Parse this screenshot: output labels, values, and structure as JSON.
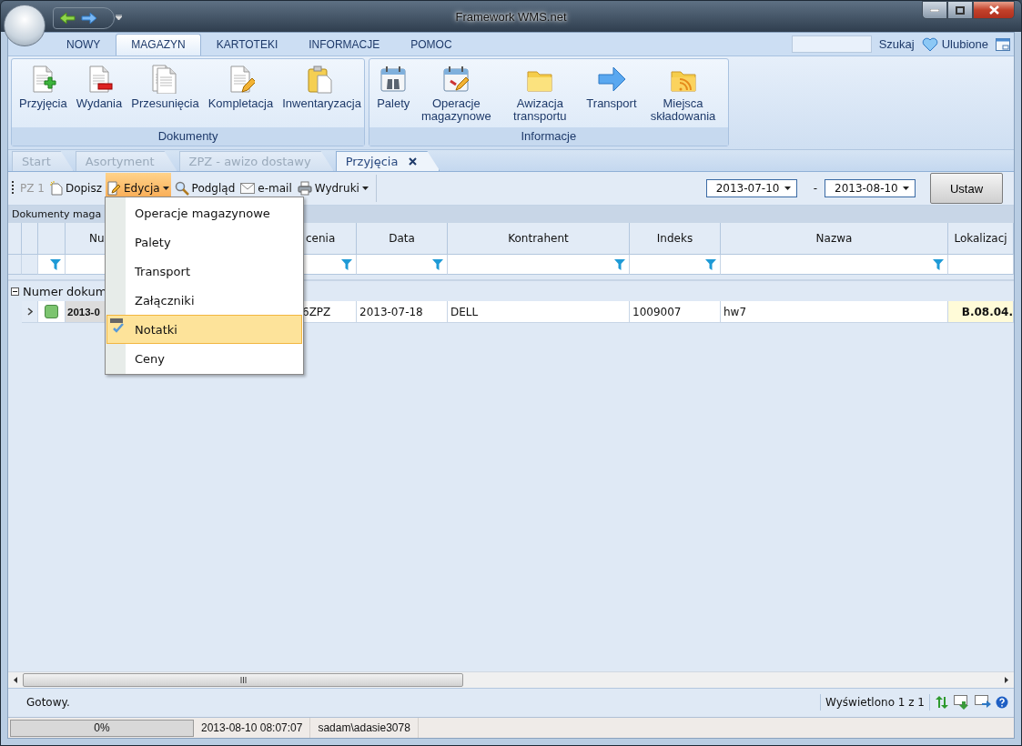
{
  "window": {
    "title": "Framework WMS.net"
  },
  "ribbon": {
    "tabs": [
      {
        "label": "NOWY",
        "selected": false
      },
      {
        "label": "MAGAZYN",
        "selected": true
      },
      {
        "label": "KARTOTEKI",
        "selected": false
      },
      {
        "label": "INFORMACJE",
        "selected": false
      },
      {
        "label": "POMOC",
        "selected": false
      }
    ],
    "search": {
      "button": "Szukaj"
    },
    "favorites": "Ulubione",
    "groups": [
      {
        "label": "Dokumenty",
        "buttons": [
          {
            "label": "Przyjęcia",
            "kind": "doc-add"
          },
          {
            "label": "Wydania",
            "kind": "doc-remove"
          },
          {
            "label": "Przesunięcia",
            "kind": "docs"
          },
          {
            "label": "Kompletacja",
            "kind": "doc-edit"
          },
          {
            "label": "Inwentaryzacja",
            "kind": "clipboard"
          }
        ]
      },
      {
        "label": "Informacje",
        "buttons": [
          {
            "label": "Palety",
            "kind": "calendar-binoculars"
          },
          {
            "label": "Operacje magazynowe",
            "kind": "calendar-edit"
          },
          {
            "label": "Awizacja transportu",
            "kind": "folder"
          },
          {
            "label": "Transport",
            "kind": "arrow"
          },
          {
            "label": "Miejsca składowania",
            "kind": "folder-feed"
          }
        ]
      }
    ]
  },
  "doc_tabs": [
    {
      "label": "Start",
      "selected": false,
      "closable": false
    },
    {
      "label": "Asortyment",
      "selected": false,
      "closable": false
    },
    {
      "label": "ZPZ - awizo dostawy",
      "selected": false,
      "closable": false
    },
    {
      "label": "Przyjęcia",
      "selected": true,
      "closable": true
    }
  ],
  "toolbar": {
    "items": [
      {
        "label": "PZ 1",
        "kind": "label",
        "disabled": true
      },
      {
        "label": "Dopisz",
        "kind": "new",
        "open": false
      },
      {
        "label": "Edycja",
        "kind": "edit-dropdown",
        "open": true
      },
      {
        "label": "Podgląd",
        "kind": "search",
        "open": false
      },
      {
        "label": "e-mail",
        "kind": "mail",
        "open": false
      },
      {
        "label": "Wydruki",
        "kind": "print-dropdown",
        "open": false
      }
    ],
    "date_from": "2013-07-10",
    "date_separator": "-",
    "date_to": "2013-08-10",
    "apply_button": "Ustaw"
  },
  "grid": {
    "caption": "Dokumenty maga",
    "marker_column_filter": true,
    "columns": [
      {
        "label": "Nu",
        "filter": false
      },
      {
        "label": "cenia",
        "filter": true
      },
      {
        "label": "Data",
        "filter": true
      },
      {
        "label": "Kontrahent",
        "filter": true
      },
      {
        "label": "Indeks",
        "filter": true
      },
      {
        "label": "Nazwa",
        "filter": true
      },
      {
        "label": "Lokalizacj",
        "filter": false
      }
    ],
    "group_row": {
      "label": "Numer dokum",
      "expanded": true
    },
    "rows": [
      {
        "cells": [
          "2013-0",
          "6ZPZ",
          "2013-07-18",
          "DELL",
          "1009007",
          "hw7",
          "B.08.04."
        ]
      }
    ]
  },
  "menu": {
    "items": [
      {
        "label": "Operacje magazynowe",
        "selected": false,
        "icon": false
      },
      {
        "label": "Palety",
        "selected": false,
        "icon": false
      },
      {
        "label": "Transport",
        "selected": false,
        "icon": false
      },
      {
        "label": "Załączniki",
        "selected": false,
        "icon": false
      },
      {
        "label": "Notatki",
        "selected": true,
        "icon": true
      },
      {
        "label": "Ceny",
        "selected": false,
        "icon": false
      }
    ]
  },
  "status": {
    "message": "Gotowy.",
    "count": "Wyświetlono 1 z 1"
  },
  "bottom_bar": {
    "progress": {
      "level": 0,
      "reading": "0%"
    },
    "datetime": "2013-08-10 08:07:07",
    "user": "sadam\\adasie3078"
  }
}
